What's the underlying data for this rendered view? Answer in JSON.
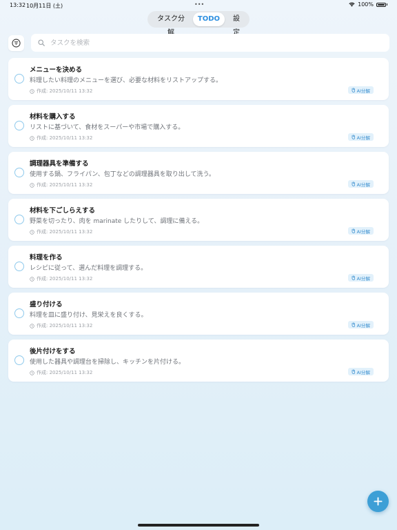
{
  "status_bar": {
    "time": "13:32",
    "date": "10月11日 (土)",
    "dots": "•••",
    "battery": "100%"
  },
  "tabs": [
    {
      "label": "タスク分解",
      "active": false
    },
    {
      "label": "TODO",
      "active": true
    },
    {
      "label": "設定",
      "active": false
    }
  ],
  "search": {
    "placeholder": "タスクを検索",
    "value": ""
  },
  "tasks": [
    {
      "title": "メニューを決める",
      "description": "料理したい料理のメニューを選び、必要な材料をリストアップする。",
      "created": "作成: 2025/10/11 13:32",
      "badge": "AI分解"
    },
    {
      "title": "材料を購入する",
      "description": "リストに基づいて、食材をスーパーや市場で購入する。",
      "created": "作成: 2025/10/11 13:32",
      "badge": "AI分解"
    },
    {
      "title": "調理器具を準備する",
      "description": "使用する鍋、フライパン、包丁などの調理器具を取り出して洗う。",
      "created": "作成: 2025/10/11 13:32",
      "badge": "AI分解"
    },
    {
      "title": "材料を下ごしらえする",
      "description": "野菜を切ったり、肉を marinate したりして、調理に備える。",
      "created": "作成: 2025/10/11 13:32",
      "badge": "AI分解"
    },
    {
      "title": "料理を作る",
      "description": "レシピに従って、選んだ料理を調理する。",
      "created": "作成: 2025/10/11 13:32",
      "badge": "AI分解"
    },
    {
      "title": "盛り付ける",
      "description": "料理を皿に盛り付け、見栄えを良くする。",
      "created": "作成: 2025/10/11 13:32",
      "badge": "AI分解"
    },
    {
      "title": "後片付けをする",
      "description": "使用した器具や調理台を掃除し、キッチンを片付ける。",
      "created": "作成: 2025/10/11 13:32",
      "badge": "AI分解"
    }
  ],
  "icons": {
    "filter": "filter-icon",
    "search": "search-icon",
    "clock": "clock-icon",
    "hand": "hand-icon",
    "add": "plus-icon"
  },
  "colors": {
    "accent": "#2d8fe0",
    "fab": "#3d9fd6",
    "badge_bg": "#e2f1fb",
    "check_border": "#8ec9ec"
  }
}
